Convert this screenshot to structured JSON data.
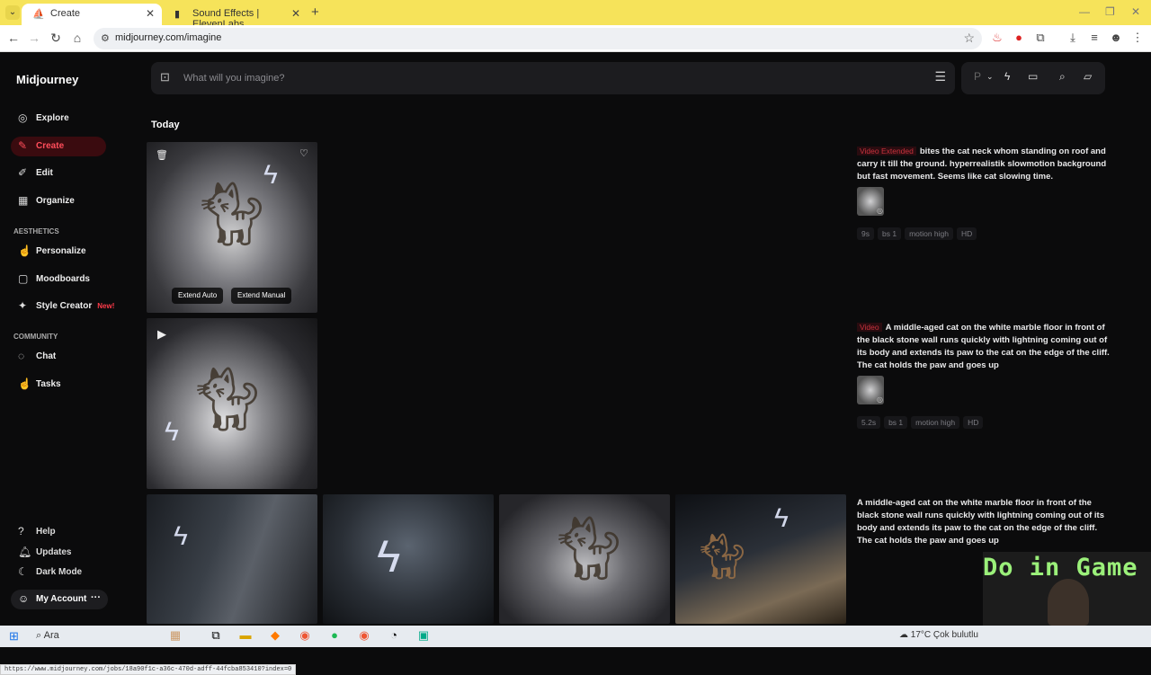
{
  "browser": {
    "tabs": [
      {
        "title": "Create",
        "active": true
      },
      {
        "title": "Sound Effects | ElevenLabs",
        "active": false
      }
    ],
    "url": "midjourney.com/imagine",
    "status_url": "https://www.midjourney.com/jobs/18a90f1c-a36c-470d-adff-44fcba853410?index=0"
  },
  "sidebar": {
    "brand": "Midjourney",
    "main": [
      {
        "label": "Explore",
        "icon": "compass-icon",
        "active": false
      },
      {
        "label": "Create",
        "icon": "brush-icon",
        "active": true
      },
      {
        "label": "Edit",
        "icon": "edit-icon",
        "active": false
      },
      {
        "label": "Organize",
        "icon": "grid-icon",
        "active": false
      }
    ],
    "aesthetics_heading": "AESTHETICS",
    "aesthetics": [
      {
        "label": "Personalize",
        "icon": "thumbs-up-icon"
      },
      {
        "label": "Moodboards",
        "icon": "board-icon"
      },
      {
        "label": "Style Creator",
        "icon": "style-icon",
        "badge": "New!"
      }
    ],
    "community_heading": "COMMUNITY",
    "community": [
      {
        "label": "Chat",
        "icon": "chat-icon"
      },
      {
        "label": "Tasks",
        "icon": "tasks-icon"
      }
    ],
    "footer": [
      {
        "label": "Help",
        "icon": "help-icon"
      },
      {
        "label": "Updates",
        "icon": "bell-icon"
      },
      {
        "label": "Dark Mode",
        "icon": "moon-icon"
      }
    ],
    "account": "My Account"
  },
  "prompt": {
    "placeholder": "What will you imagine?"
  },
  "feed": {
    "heading": "Today",
    "overlay_buttons": [
      "Extend Auto",
      "Extend Manual"
    ],
    "jobs": [
      {
        "tag": "Video Extended",
        "prompt": "bites the cat neck whom standing on roof and carry it till the ground. hyperrealistik slowmotion background but fast movement. Seems like cat slowing time.",
        "chips": [
          "9s",
          "bs 1",
          "motion high",
          "HD"
        ]
      },
      {
        "tag": "Video",
        "prompt": "A middle-aged cat on the white marble floor in front of the black stone wall runs quickly with lightning coming out of its body and extends its paw to the cat on the edge of the cliff. The cat holds the paw and goes up",
        "chips": [
          "5.2s",
          "bs 1",
          "motion high",
          "HD"
        ]
      },
      {
        "tag": "",
        "prompt": "A middle-aged cat on the white marble floor in front of the black stone wall runs quickly with lightning coming out of its body and extends its paw to the cat on the edge of the cliff. The cat holds the paw and goes up",
        "chips": []
      }
    ]
  },
  "overlay": {
    "watermark": "Do in Game"
  },
  "taskbar": {
    "search": "Ara",
    "weather": "17°C  Çok bulutlu"
  }
}
